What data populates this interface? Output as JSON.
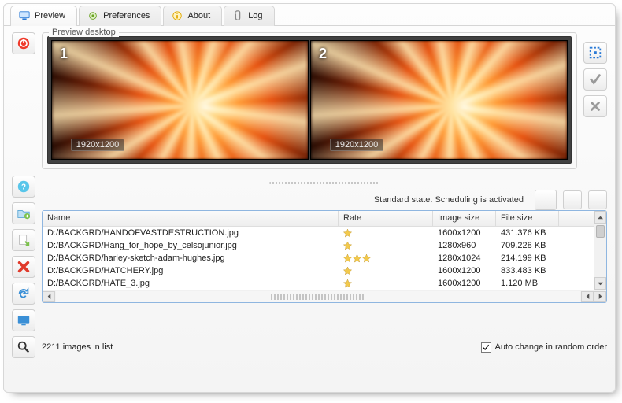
{
  "tabs": [
    {
      "label": "Preview",
      "color": "#2a7ad6"
    },
    {
      "label": "Preferences",
      "color": "#6aa323"
    },
    {
      "label": "About",
      "color": "#f2c14e"
    },
    {
      "label": "Log",
      "color": "#9a9a9a"
    }
  ],
  "active_tab": 0,
  "preview": {
    "legend": "Preview desktop",
    "monitors": [
      {
        "n": "1",
        "res": "1920x1200"
      },
      {
        "n": "2",
        "res": "1920x1200"
      }
    ]
  },
  "status_text": "Standard state. Scheduling is activated",
  "columns": {
    "name": "Name",
    "rate": "Rate",
    "isize": "Image size",
    "fsize": "File size"
  },
  "rows": [
    {
      "name": "D:/BACKGRD/HANDOFVASTDESTRUCTION.jpg",
      "rate": 1,
      "isize": "1600x1200",
      "fsize": "431.376 KB"
    },
    {
      "name": "D:/BACKGRD/Hang_for_hope_by_celsojunior.jpg",
      "rate": 1,
      "isize": "1280x960",
      "fsize": "709.228 KB"
    },
    {
      "name": "D:/BACKGRD/harley-sketch-adam-hughes.jpg",
      "rate": 3,
      "isize": "1280x1024",
      "fsize": "214.199 KB"
    },
    {
      "name": "D:/BACKGRD/HATCHERY.jpg",
      "rate": 1,
      "isize": "1600x1200",
      "fsize": "833.483 KB"
    },
    {
      "name": "D:/BACKGRD/HATE_3.jpg",
      "rate": 1,
      "isize": "1600x1200",
      "fsize": "1.120 MB"
    }
  ],
  "footer": {
    "count_text": "2211 images in list",
    "random_label": "Auto change in random order",
    "random_checked": true
  },
  "icons": {
    "power": "power-icon",
    "help": "help-icon",
    "folder_add": "folder-add-icon",
    "export": "export-icon",
    "delete": "delete-icon",
    "refresh": "refresh-icon",
    "display": "display-icon",
    "search": "search-icon",
    "swap": "swap-icon",
    "calendar": "calendar-icon",
    "columns": "columns-icon",
    "expand": "expand-icon",
    "accept": "accept-icon",
    "reject": "reject-icon",
    "monitor": "monitor-icon",
    "gear": "gear-icon",
    "info": "info-icon",
    "clip": "clip-icon"
  }
}
